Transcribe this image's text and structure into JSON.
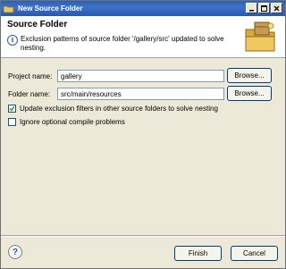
{
  "window": {
    "title": "New Source Folder",
    "controls": [
      "minimize",
      "maximize",
      "close"
    ]
  },
  "header": {
    "title": "Source Folder",
    "message": "Exclusion patterns of source folder '/gallery/src' updated to solve nesting.",
    "icon": "info-icon",
    "graphic": "folder-package-graphic"
  },
  "form": {
    "project_name_label": "Project name:",
    "project_name_value": "gallery",
    "folder_name_label": "Folder name:",
    "folder_name_value": "src/main/resources",
    "browse_label": "Browse...",
    "update_exclusion_label": "Update exclusion filters in other source folders to solve nesting",
    "update_exclusion_checked": true,
    "ignore_optional_label": "Ignore optional compile problems",
    "ignore_optional_checked": false
  },
  "footer": {
    "help_label": "?",
    "finish_label": "Finish",
    "cancel_label": "Cancel"
  }
}
